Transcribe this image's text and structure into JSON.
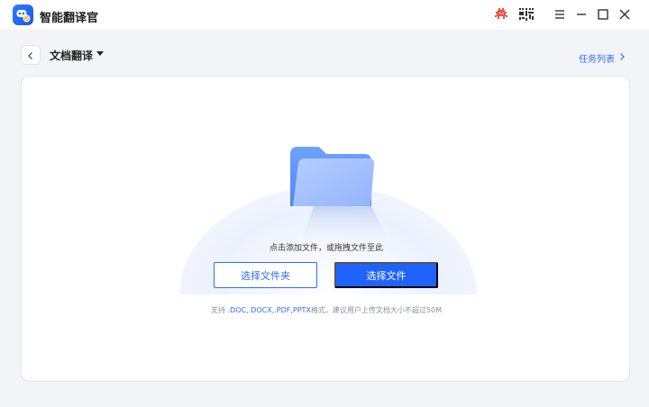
{
  "app": {
    "title": "智能翻译官"
  },
  "header": {
    "title": "文档翻译",
    "task_list_label": "任务列表"
  },
  "upload": {
    "hint": "点击添加文件，或拖拽文件至此",
    "select_folder_label": "选择文件夹",
    "select_file_label": "选择文件",
    "support_prefix": "支持 ",
    "support_formats": ".DOC,.DOCX,.PDF,PPTX",
    "support_suffix": "格式，建议用户上传文档大小不超过50M"
  },
  "colors": {
    "accent": "#1f63ff",
    "link": "#2f6bff",
    "background": "#f3f4f7",
    "panel": "#ffffff",
    "muted_text": "#8a8f99"
  },
  "icons": {
    "app_logo": "robot-logo-icon",
    "titlebar_left": "bug-icon",
    "titlebar_right": "qr-code-icon",
    "menu": "hamburger-menu-icon",
    "minimize": "minimize-icon",
    "maximize": "maximize-icon",
    "close": "close-icon",
    "back": "chevron-left-icon",
    "task_list": "chevron-right-icon",
    "folder": "folder-icon"
  }
}
